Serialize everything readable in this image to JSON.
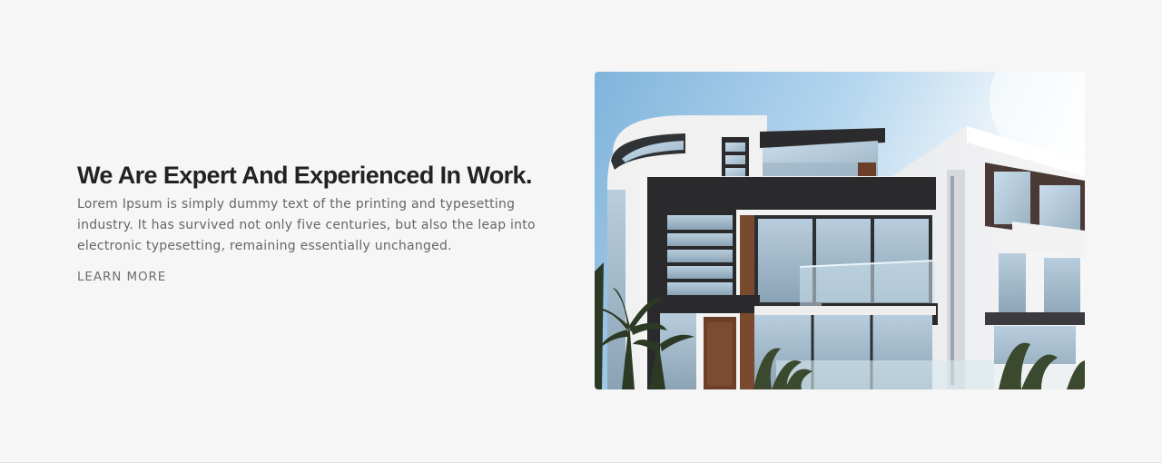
{
  "about": {
    "heading": "We Are Expert And Experienced In Work.",
    "body": "Lorem Ipsum is simply dummy text of the printing and typesetting industry. It has survived not only five centuries, but also the leap into electronic typesetting, remaining essentially unchanged.",
    "link_label": "LEARN MORE"
  },
  "colors": {
    "background": "#f6f6f6",
    "heading": "#222222",
    "body_text": "#666666",
    "link": "#6f6f6f"
  }
}
